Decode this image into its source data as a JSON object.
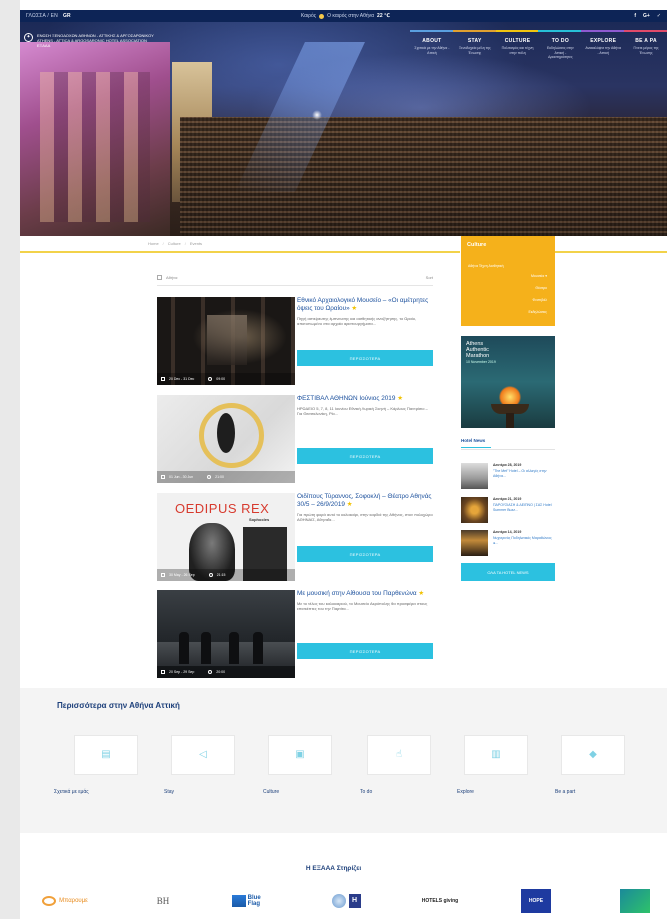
{
  "topbar": {
    "lang_label": "ΓΛΩΣΣΑ / EN",
    "lang_active": "GR",
    "weather_label": "Καιρός",
    "weather_text": "Ο καιρός στην Αθήνα",
    "weather_temp": "22 ℃",
    "social": [
      "f",
      "G+",
      "✓"
    ]
  },
  "header": {
    "org_lines": [
      "ΕΝΩΣΗ ΞΕΝΟΔΟΧΩΝ ΑΘΗΝΩΝ - ΑΤΤΙΚΗΣ & ΑΡΓΟΣΑΡΩΝΙΚΟΥ",
      "ATHENS - ATTICA & ARGOSARONIC HOTEL ASSOCIATION",
      "ΕΞΑΑΑ"
    ],
    "nav": [
      {
        "label": "ABOUT",
        "sub": "Σχετικά με την Αθήνα - Αττική"
      },
      {
        "label": "STAY",
        "sub": "Ξενοδοχεία μέλη της Ένωσης"
      },
      {
        "label": "CULTURE",
        "sub": "Πολιτισμός και τέχνη στην πόλη"
      },
      {
        "label": "TO DO",
        "sub": "Εκδηλώσεις στην Αττική - Δραστηριότητες"
      },
      {
        "label": "EXPLORE",
        "sub": "Ανακαλύψτε την Αθήνα - Αττική"
      },
      {
        "label": "BE A PA",
        "sub": "Γίνετε μέρος της Ένωσης"
      }
    ]
  },
  "breadcrumb": [
    "Home",
    "Culture",
    "Events"
  ],
  "list_toolbar": {
    "view_label": "Αθήνα",
    "sort_label": "Sort"
  },
  "events": [
    {
      "title": "Εθνικό Αρχαιολογικό Μουσείο – «Οι αμέτρητες όψεις του Ωραίου»",
      "desc": "Πηγή αστείρευτης έμπνευσης και αισθητικής αναζήτησης, το Ωραίο, αποτυπωμένο στα αρχαία αριστουργήματα...",
      "date": "20 Dec - 31 Dec",
      "time": "09:00",
      "button": "ΠΕΡΙΣΣΟΤΕΡΑ"
    },
    {
      "title": "ΦΕΣΤΙΒΑΛ ΑΘΗΝΩΝ Ιούνιος 2019",
      "desc": "ΗΡΩΔΕΙΟ 5, 7, 8, 11 Ιουνίου Εθνική Λυρική Σκηνή – Κάρλους Παντρίσιο – Για Θεσσαλονίκη, Ρίο...",
      "date": "01 Jun - 30 Jun",
      "time": "21:00",
      "button": "ΠΕΡΙΣΣΟΤΕΡΑ"
    },
    {
      "title": "Οιδίπους Τύραννος, Σοφοκλή – Θέατρο Αθηνάς 30/5 – 26/9/2019",
      "desc": "Για πρώτη φορά αυτό το καλοκαίρι, στην καρδιά της Αθήνας, στον πολυχώρο ΑΘΗΝΑΙΣ, Αθηναΐα...",
      "date": "30 May - 26 Sep",
      "time": "21:15",
      "button": "ΠΕΡΙΣΣΟΤΕΡΑ"
    },
    {
      "title": "Με μουσική στην Αίθουσα του Παρθενώνα",
      "desc": "Με το τέλος του καλοκαιριού, το Μουσείο Ακρόπολης θα προσφέρει στους επισκέπτες του την Παρτίτα...",
      "date": "20 Sep - 29 Sep",
      "time": "20:00",
      "button": "ΠΕΡΙΣΣΟΤΕΡΑ"
    }
  ],
  "poster": {
    "title": "OEDIPUS REX",
    "subtitle": "Sophocles"
  },
  "sidebar": {
    "culture_title": "Culture",
    "culture_items": [
      "Αθήνα Τέχνη Αισθητική",
      "Μουσεία",
      "Θέατρο",
      "Φεστιβάλ",
      "Εκδηλώσεις"
    ],
    "ad": {
      "line1": "Athens",
      "line2": "Authentic",
      "line3": "Marathon",
      "small": "10 November 2019"
    },
    "hotel_news_title": "Hotel News",
    "news": [
      {
        "date": "Δευτέρα 28, 2019",
        "title": "\"The Met\" Hotel – Οι αλλαγές στην Αθήνα..."
      },
      {
        "date": "Δευτέρα 21, 2019",
        "title": "ΠΑΡΟΥΣΙΑΣΗ & ΔΕΙΠΝΟ | ΣΑΣ Hotel Summer Buzz..."
      },
      {
        "date": "Δευτέρα 14, 2019",
        "title": "Νυχτερινός Ποδηλατικός Μαραθώνιος ●..."
      }
    ],
    "all_hotels_button": "ΟΛΑ ΤΑ HOTEL NEWS"
  },
  "more": {
    "title": "Περισσότερα στην Αθήνα Αττική",
    "tiles": [
      {
        "label": "Σχετικά με εμάς",
        "icon": "info-icon"
      },
      {
        "label": "Stay",
        "icon": "megaphone-icon"
      },
      {
        "label": "Culture",
        "icon": "chat-icon"
      },
      {
        "label": "To do",
        "icon": "hand-icon"
      },
      {
        "label": "Explore",
        "icon": "shirt-icon"
      },
      {
        "label": "Be a part",
        "icon": "tag-icon"
      }
    ]
  },
  "support": {
    "title": "Η ΕΞΑΑΑ Στηρίζει",
    "partners": [
      "Μπαρουμε",
      "BH",
      "Blue Flag",
      "Η",
      "HOTELS giving",
      "HOPE",
      ""
    ]
  },
  "colors": {
    "navy": "#0d2456",
    "accent_blue": "#2cc1e0",
    "culture_orange": "#f5b11b",
    "title_blue": "#1a4f9c",
    "rule_yellow": "#f2d24a"
  }
}
